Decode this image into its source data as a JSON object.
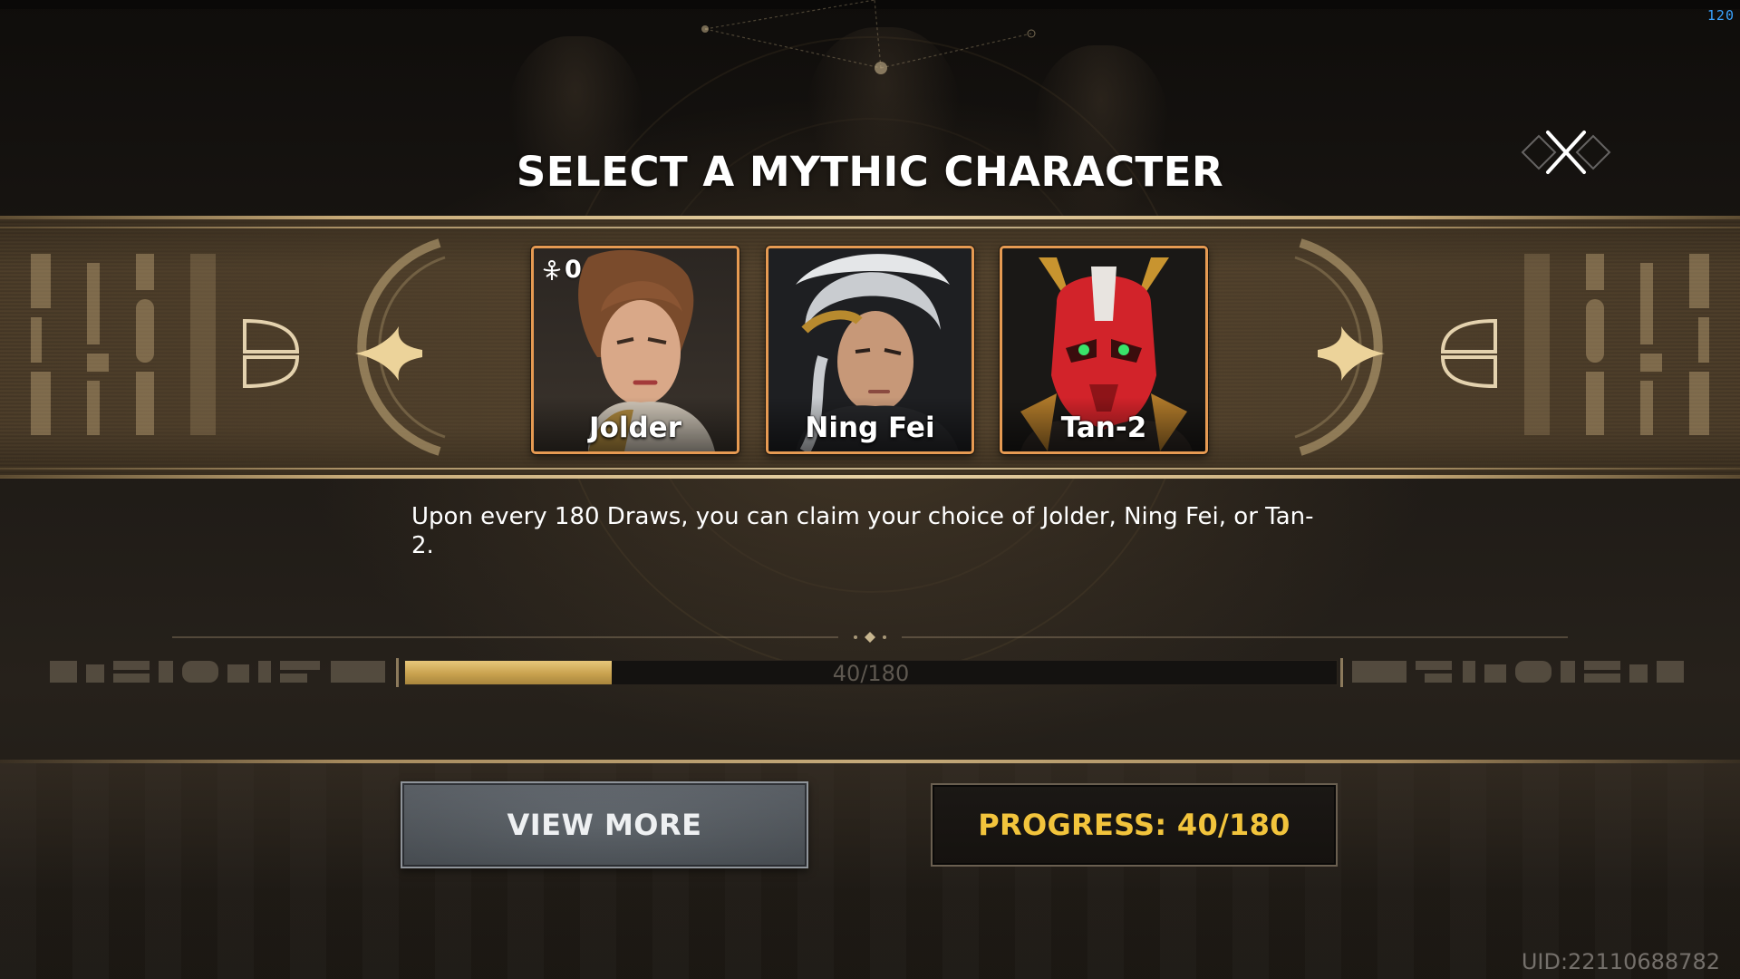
{
  "hud": {
    "fps": "120",
    "uid": "UID:22110688782"
  },
  "header": {
    "title": "SELECT A MYTHIC CHARACTER"
  },
  "characters": [
    {
      "name": "Jolder",
      "owned_count": "0"
    },
    {
      "name": "Ning Fei"
    },
    {
      "name": "Tan-2"
    }
  ],
  "description": "Upon every 180 Draws, you can claim your choice of Jolder, Ning Fei, or Tan-2.",
  "progress_bar": {
    "label": "40/180",
    "current": 40,
    "total": 180
  },
  "buttons": {
    "view_more": "VIEW MORE",
    "progress": "PROGRESS: 40/180"
  },
  "colors": {
    "accent_gold": "#f2c43c",
    "card_border": "#e69a52",
    "progress_fill": "#c9a24f"
  }
}
